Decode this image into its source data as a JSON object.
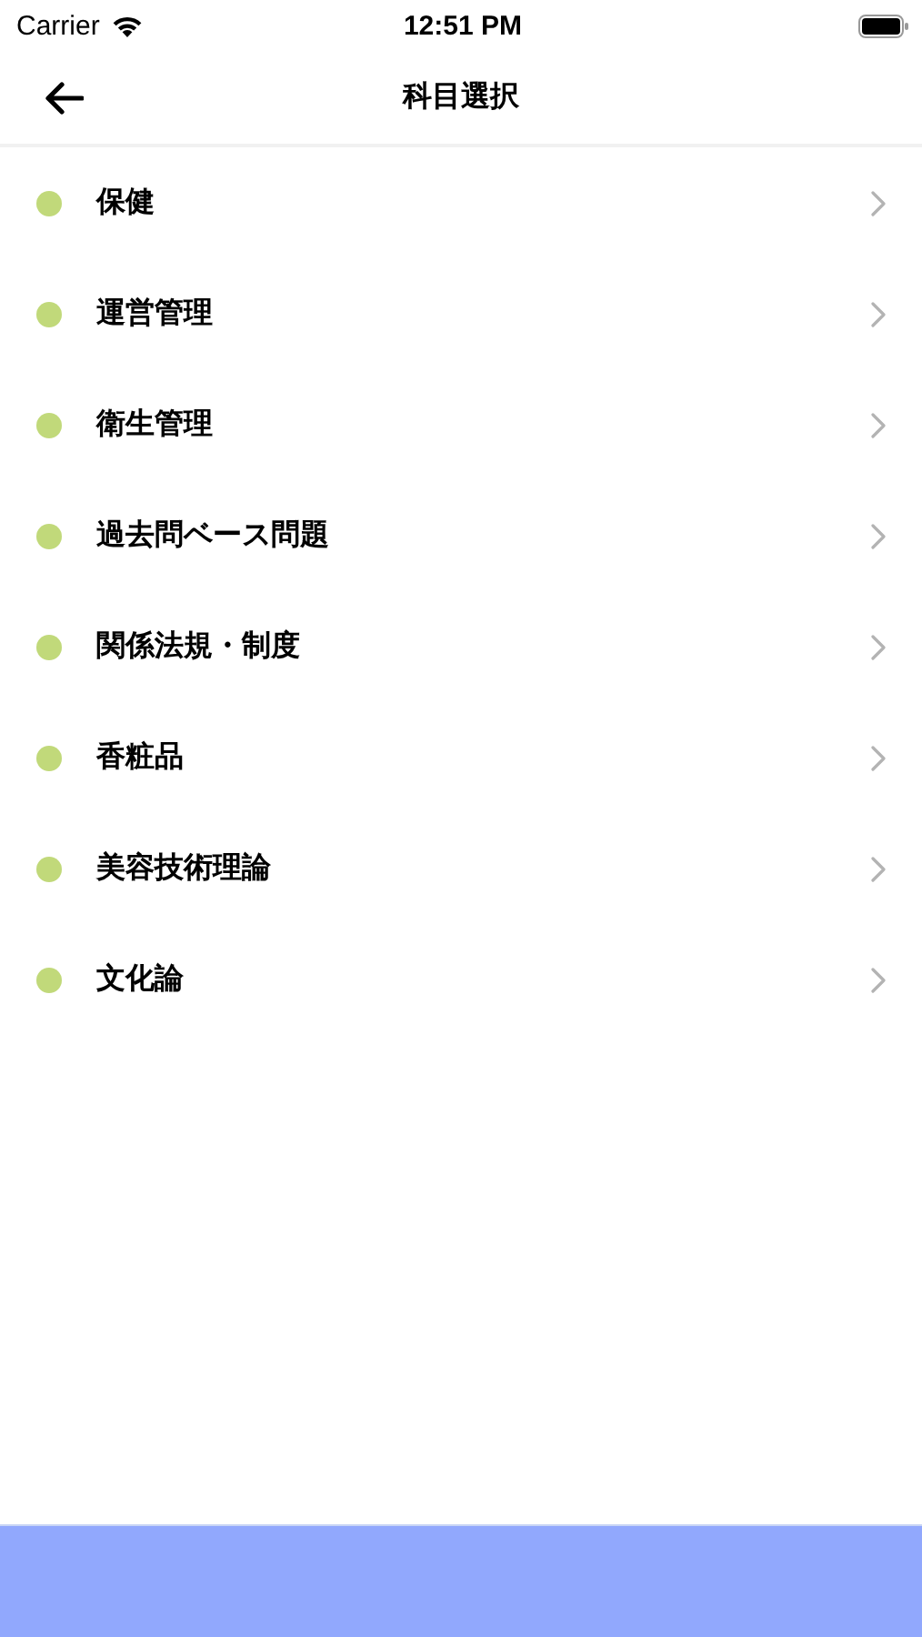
{
  "status_bar": {
    "carrier": "Carrier",
    "time": "12:51 PM"
  },
  "nav_bar": {
    "title": "科目選択"
  },
  "subjects": [
    {
      "label": "保健"
    },
    {
      "label": "運営管理"
    },
    {
      "label": "衛生管理"
    },
    {
      "label": "過去問ベース問題"
    },
    {
      "label": "関係法規・制度"
    },
    {
      "label": "香粧品"
    },
    {
      "label": "美容技術理論"
    },
    {
      "label": "文化論"
    }
  ]
}
